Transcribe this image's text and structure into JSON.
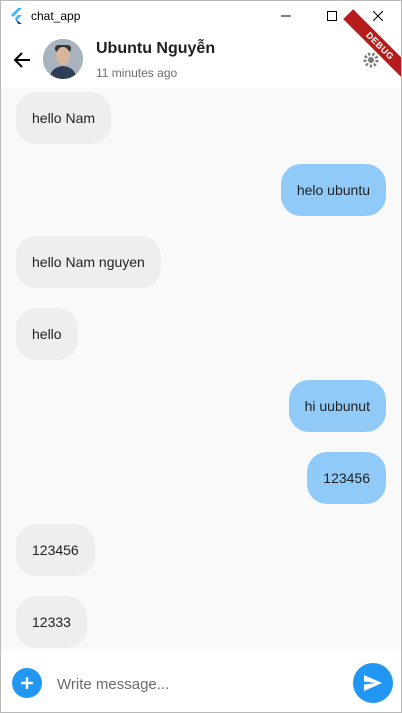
{
  "window": {
    "title": "chat_app"
  },
  "header": {
    "contact_name": "Ubuntu Nguyễn",
    "last_seen": "11 minutes ago",
    "debug_label": "DEBUG"
  },
  "messages": [
    {
      "direction": "in",
      "text": "hello Nam"
    },
    {
      "direction": "out",
      "text": "helo ubuntu"
    },
    {
      "direction": "in",
      "text": "hello Nam nguyen"
    },
    {
      "direction": "in",
      "text": "hello"
    },
    {
      "direction": "out",
      "text": "hi uubunut"
    },
    {
      "direction": "out",
      "text": "123456"
    },
    {
      "direction": "in",
      "text": "123456"
    },
    {
      "direction": "in",
      "text": "12333"
    }
  ],
  "composer": {
    "placeholder": "Write message..."
  },
  "colors": {
    "accent": "#2196f3",
    "outgoing_bubble": "#90caf9",
    "incoming_bubble": "#eeeeee",
    "debug_banner": "#b71c1c"
  }
}
